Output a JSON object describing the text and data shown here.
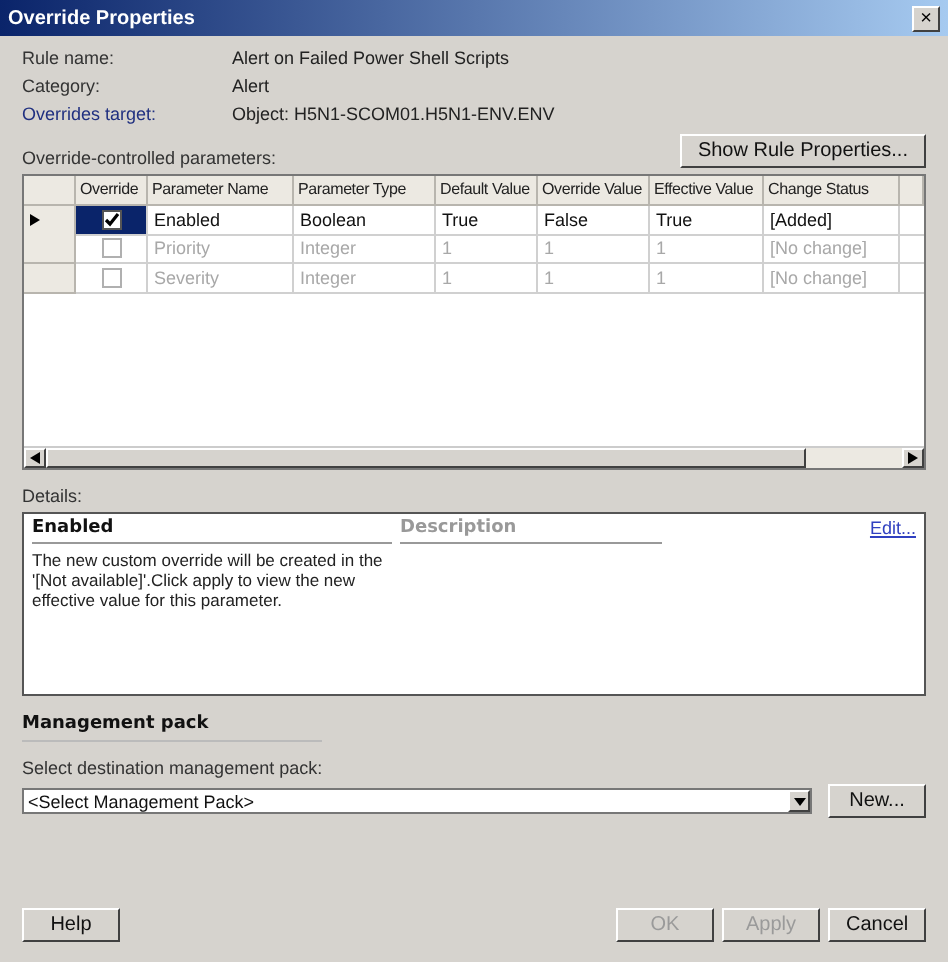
{
  "window": {
    "title": "Override Properties",
    "close": "×"
  },
  "info": [
    {
      "label": "Rule name:",
      "value": "Alert on Failed Power Shell Scripts"
    },
    {
      "label": "Category:",
      "value": "Alert"
    },
    {
      "label": "Overrides target:",
      "value": "Object: H5N1-SCOM01.H5N1-ENV.ENV"
    }
  ],
  "parameters_label": "Override-controlled parameters:",
  "show_rule_button": "Show Rule Properties...",
  "table": {
    "columns": [
      "Override",
      "Parameter Name",
      "Parameter Type",
      "Default Value",
      "Override Value",
      "Effective Value",
      "Change Status"
    ],
    "rows": [
      {
        "selected": true,
        "checked": true,
        "disabled": false,
        "cells": [
          "",
          "Enabled",
          "Boolean",
          "True",
          "False",
          "True",
          "[Added]"
        ]
      },
      {
        "selected": false,
        "checked": false,
        "disabled": true,
        "cells": [
          "",
          "Priority",
          "Integer",
          "1",
          "1",
          "1",
          "[No change]"
        ]
      },
      {
        "selected": false,
        "checked": false,
        "disabled": true,
        "cells": [
          "",
          "Severity",
          "Integer",
          "1",
          "1",
          "1",
          "[No change]"
        ]
      }
    ]
  },
  "details": {
    "label": "Details:",
    "title": "Enabled",
    "description_heading": "Description",
    "edit_link": "Edit...",
    "text": "The new custom override will be created in the '[Not available]'.Click apply to view  the new effective value for this parameter."
  },
  "management_pack": {
    "heading": "Management pack",
    "label": "Select destination management pack:",
    "value": "<Select Management Pack>",
    "new_button": "New..."
  },
  "buttons": [
    {
      "label": "Help",
      "disabled": false
    },
    {
      "label": "OK",
      "disabled": true
    },
    {
      "label": "Apply",
      "disabled": true
    },
    {
      "label": "Cancel",
      "disabled": false
    }
  ]
}
